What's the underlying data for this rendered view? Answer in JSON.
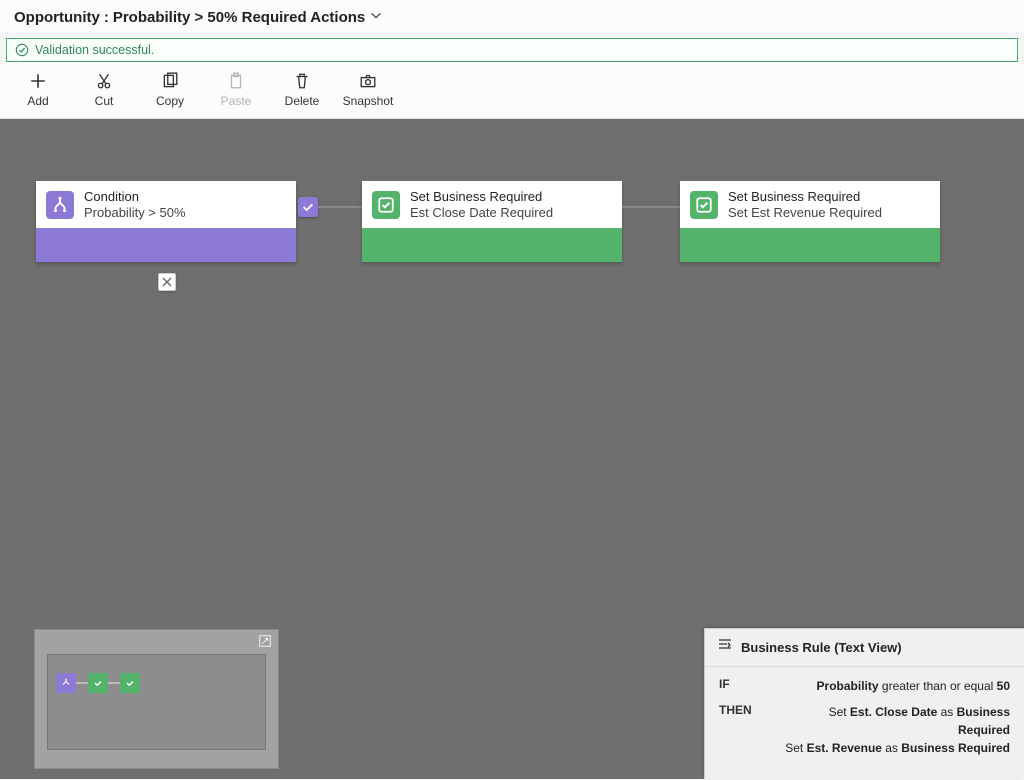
{
  "header": {
    "entity": "Opportunity",
    "rule_name": "Probability > 50% Required Actions"
  },
  "validation": {
    "message": "Validation successful."
  },
  "toolbar": {
    "add": "Add",
    "cut": "Cut",
    "copy": "Copy",
    "paste": "Paste",
    "delete": "Delete",
    "snapshot": "Snapshot"
  },
  "nodes": {
    "condition": {
      "title": "Condition",
      "subtitle": "Probability > 50%"
    },
    "action1": {
      "title": "Set Business Required",
      "subtitle": "Est Close Date Required"
    },
    "action2": {
      "title": "Set Business Required",
      "subtitle": "Set Est Revenue Required"
    }
  },
  "textview": {
    "title": "Business Rule (Text View)",
    "if_label": "IF",
    "then_label": "THEN",
    "if_field": "Probability",
    "if_op": "greater than or equal",
    "if_value": "50",
    "then_prefix": "Set",
    "then_as": "as",
    "then_req": "Business Required",
    "then_f1": "Est. Close Date",
    "then_f2": "Est. Revenue"
  }
}
